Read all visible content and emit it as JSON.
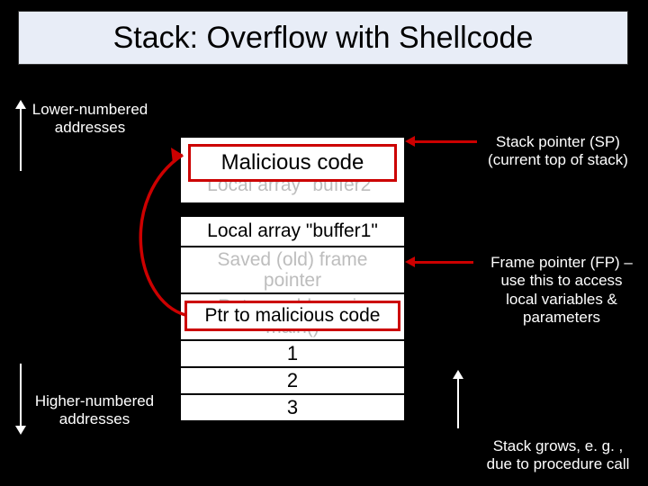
{
  "title": "Stack: Overflow with Shellcode",
  "labels": {
    "lower": "Lower-numbered\naddresses",
    "higher": "Higher-numbered\naddresses",
    "sp": "Stack pointer (SP)\n(current top of stack)",
    "fp": "Frame pointer (FP) –\nuse this to access\nlocal variables &\nparameters",
    "grows": "Stack grows, e. g. ,\ndue to procedure call"
  },
  "stack": {
    "buffer2": "Local array \"buffer2\"",
    "buffer1": "Local array \"buffer1\"",
    "savedfp": "Saved (old) frame\npointer",
    "retaddr": "Return address in\nmain()",
    "p1": "1",
    "p2": "2",
    "p3": "3"
  },
  "overlay": {
    "malicious": "Malicious code",
    "ptr": "Ptr to malicious code"
  },
  "colors": {
    "accent": "#cc0000",
    "titlebg": "#e8edf7"
  }
}
